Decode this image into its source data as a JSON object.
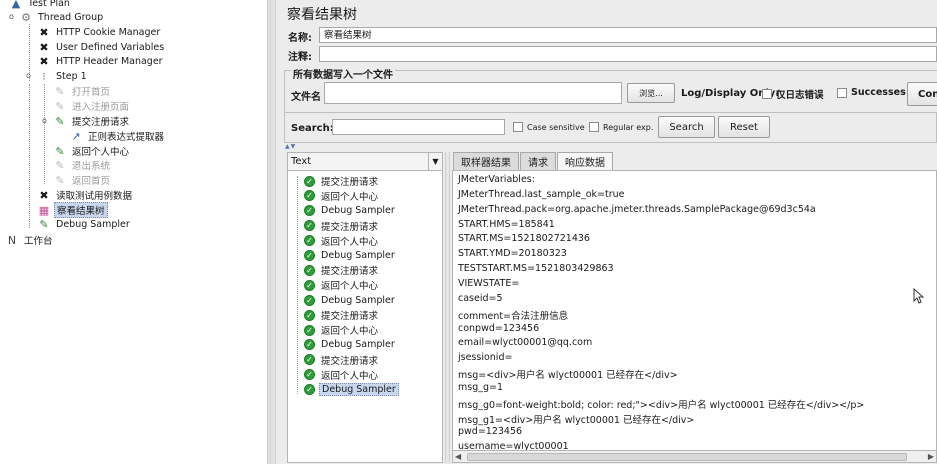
{
  "tree": {
    "items": [
      {
        "label": "Test Plan",
        "icon": "test-plan-icon"
      },
      {
        "label": "Thread Group",
        "icon": "gear-icon"
      },
      {
        "label": "HTTP Cookie Manager",
        "icon": "wrench-icon"
      },
      {
        "label": "User Defined Variables",
        "icon": "wrench-icon"
      },
      {
        "label": "HTTP Header Manager",
        "icon": "wrench-icon"
      },
      {
        "label": "Step 1",
        "icon": "controller-icon"
      },
      {
        "label": "打开首页",
        "icon": "pencil-icon"
      },
      {
        "label": "进入注册页面",
        "icon": "pencil-icon"
      },
      {
        "label": "提交注册请求",
        "icon": "pencil-icon"
      },
      {
        "label": "正则表达式提取器",
        "icon": "extractor-icon"
      },
      {
        "label": "返回个人中心",
        "icon": "pencil-icon"
      },
      {
        "label": "退出系统",
        "icon": "pencil-icon"
      },
      {
        "label": "返回首页",
        "icon": "pencil-icon"
      },
      {
        "label": "读取测试用例数据",
        "icon": "wrench-icon"
      },
      {
        "label": "察看结果树",
        "icon": "chart-icon"
      },
      {
        "label": "Debug Sampler",
        "icon": "pencil-icon"
      },
      {
        "label": "工作台",
        "icon": "workbench-icon"
      }
    ]
  },
  "panel": {
    "title": "察看结果树",
    "name_label": "名称:",
    "name_value": "察看结果树",
    "comment_label": "注释:",
    "file_section": "所有数据写入一个文件",
    "filename_label": "文件名",
    "browse_button": "浏览...",
    "log_display_label": "Log/Display Only:",
    "errors_only_label": "仅日志错误",
    "successes_label": "Successes",
    "configure_button": "Con"
  },
  "search": {
    "label": "Search:",
    "case_sensitive": "Case sensitive",
    "regular_exp": "Regular exp.",
    "search_button": "Search",
    "reset_button": "Reset"
  },
  "results": {
    "renderer": "Text",
    "items": [
      "提交注册请求",
      "返回个人中心",
      "Debug Sampler",
      "提交注册请求",
      "返回个人中心",
      "Debug Sampler",
      "提交注册请求",
      "返回个人中心",
      "Debug Sampler",
      "提交注册请求",
      "返回个人中心",
      "Debug Sampler",
      "提交注册请求",
      "返回个人中心",
      "Debug Sampler"
    ]
  },
  "tabs": [
    "取样器结果",
    "请求",
    "响应数据"
  ],
  "response_lines": [
    "JMeterVariables:",
    "JMeterThread.last_sample_ok=true",
    "JMeterThread.pack=org.apache.jmeter.threads.SamplePackage@69d3c54a",
    "START.HMS=185841",
    "START.MS=1521802721436",
    "START.YMD=20180323",
    "TESTSTART.MS=1521803429863",
    "VIEWSTATE=",
    "caseid=5",
    "comment=合法注册信息",
    "conpwd=123456",
    "email=wlyct00001@qq.com",
    "jsessionid=",
    "msg=<div>用户名 wlyct00001 已经存在</div>",
    "msg_g=1",
    "msg_g0=font-weight:bold; color: red;\"><div>用户名 wlyct00001 已经存在</div></p>",
    "msg_g1=<div>用户名 wlyct00001 已经存在</div>",
    "pwd=123456",
    "username=wlyct00001"
  ]
}
